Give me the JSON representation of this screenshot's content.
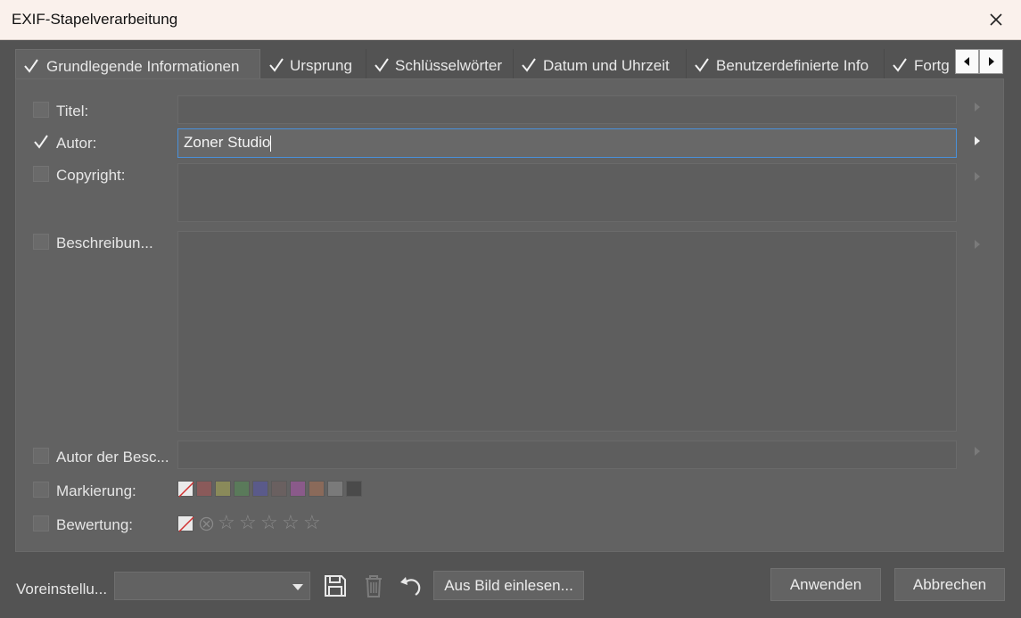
{
  "window": {
    "title": "EXIF-Stapelverarbeitung"
  },
  "tabs": [
    {
      "label": "Grundlegende Informationen",
      "checked": true,
      "active": true
    },
    {
      "label": "Ursprung",
      "checked": true
    },
    {
      "label": "Schlüsselwörter",
      "checked": true
    },
    {
      "label": "Datum und Uhrzeit",
      "checked": true
    },
    {
      "label": "Benutzerdefinierte Info",
      "checked": true
    },
    {
      "label": "Fortg",
      "checked": true
    }
  ],
  "fields": {
    "title": {
      "label": "Titel:",
      "checked": false,
      "value": ""
    },
    "author": {
      "label": "Autor:",
      "checked": true,
      "value": "Zoner Studio"
    },
    "copyright": {
      "label": "Copyright:",
      "checked": false,
      "value": ""
    },
    "description": {
      "label": "Beschreibun...",
      "checked": false,
      "value": ""
    },
    "description_author": {
      "label": "Autor der Besc...",
      "checked": false,
      "value": ""
    },
    "marking": {
      "label": "Markierung:",
      "checked": false
    },
    "rating": {
      "label": "Bewertung:",
      "checked": false
    }
  },
  "marking_colors": [
    "#8a5a5a",
    "#8a8a5a",
    "#5a7a5a",
    "#5a5a8a",
    "#6a6060",
    "#8a5a8a",
    "#8a6a5a",
    "#7a7a7a",
    "#4a4a4a"
  ],
  "rating_stars": 5,
  "bottom": {
    "preset_label": "Voreinstellu...",
    "preset_value": "",
    "read_from_image": "Aus Bild einlesen...",
    "apply": "Anwenden",
    "cancel": "Abbrechen"
  },
  "colors": {
    "titlebar": "#faf1ec",
    "focus": "#4a90d9",
    "background": "#535353"
  }
}
